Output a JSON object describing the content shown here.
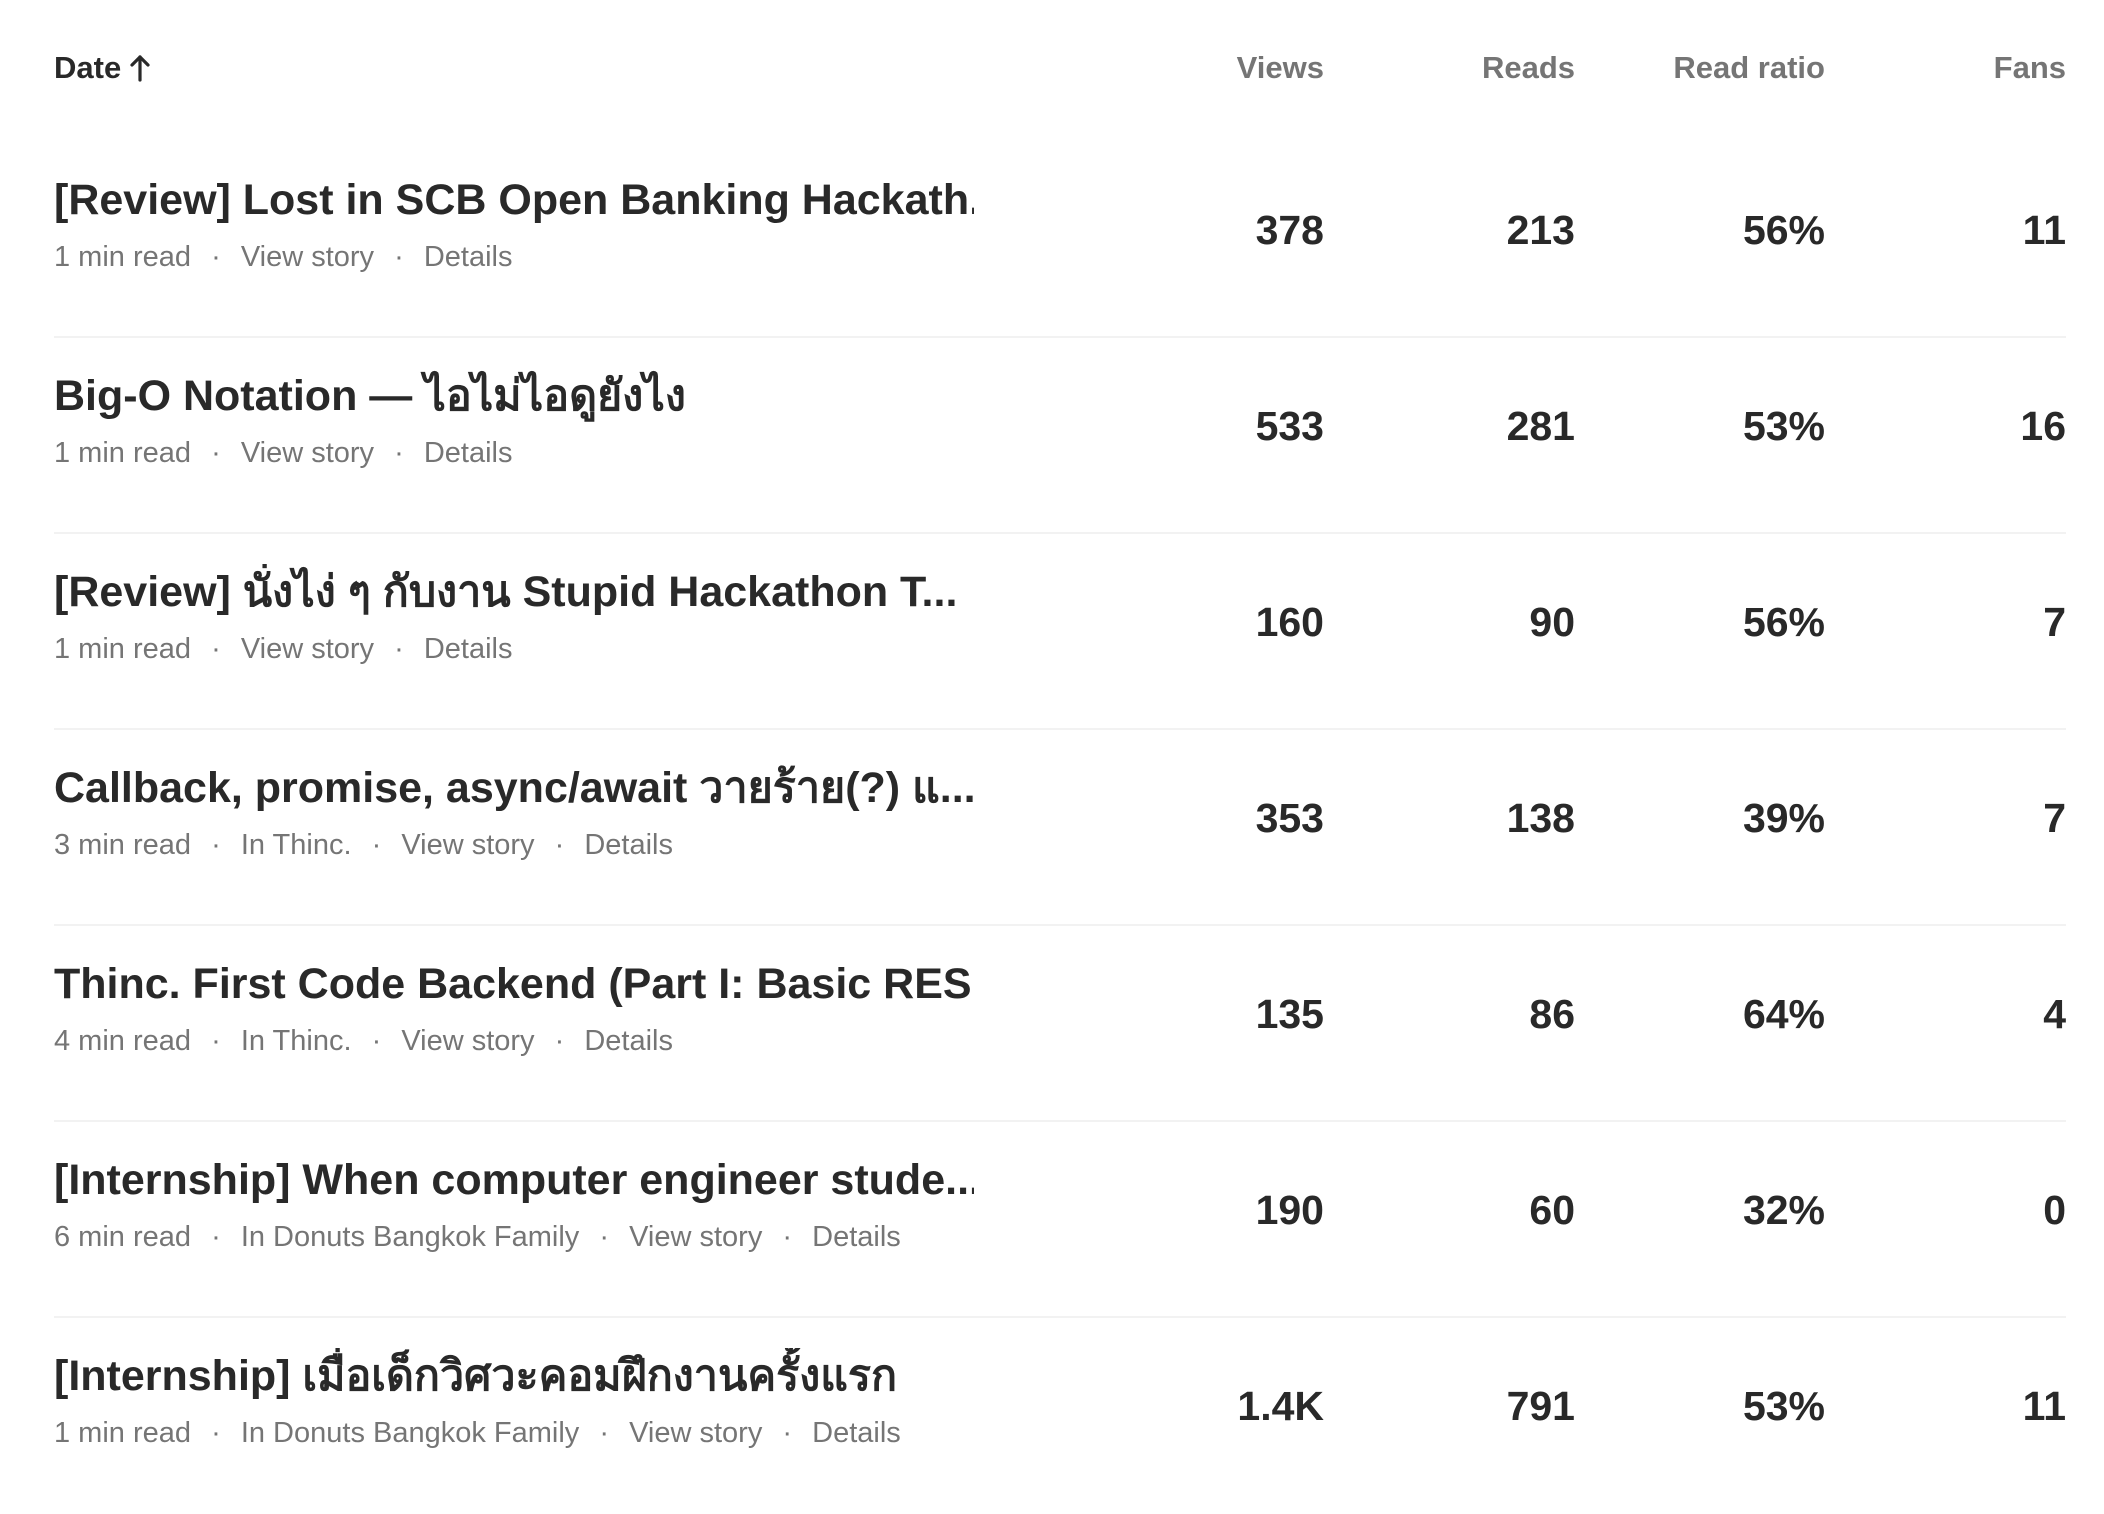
{
  "header": {
    "date_label": "Date",
    "views_label": "Views",
    "reads_label": "Reads",
    "read_ratio_label": "Read ratio",
    "fans_label": "Fans"
  },
  "rows": [
    {
      "title": "[Review] Lost in SCB Open Banking Hackath...",
      "read_time": "1 min read",
      "publication": "",
      "view_story": "View story",
      "details": "Details",
      "views": "378",
      "reads": "213",
      "read_ratio": "56%",
      "fans": "11"
    },
    {
      "title": "Big-O Notation — ไอไม่ไอดูยังไง",
      "read_time": "1 min read",
      "publication": "",
      "view_story": "View story",
      "details": "Details",
      "views": "533",
      "reads": "281",
      "read_ratio": "53%",
      "fans": "16"
    },
    {
      "title": "[Review] นั่งไง่ ๆ กับงาน Stupid Hackathon T...",
      "read_time": "1 min read",
      "publication": "",
      "view_story": "View story",
      "details": "Details",
      "views": "160",
      "reads": "90",
      "read_ratio": "56%",
      "fans": "7"
    },
    {
      "title": "Callback, promise, async/await วายร้าย(?) แ...",
      "read_time": "3 min read",
      "publication": "In Thinc.",
      "view_story": "View story",
      "details": "Details",
      "views": "353",
      "reads": "138",
      "read_ratio": "39%",
      "fans": "7"
    },
    {
      "title": "Thinc. First Code Backend (Part I: Basic RES...",
      "read_time": "4 min read",
      "publication": "In Thinc.",
      "view_story": "View story",
      "details": "Details",
      "views": "135",
      "reads": "86",
      "read_ratio": "64%",
      "fans": "4"
    },
    {
      "title": "[Internship] When computer engineer stude...",
      "read_time": "6 min read",
      "publication": "In Donuts Bangkok Family",
      "view_story": "View story",
      "details": "Details",
      "views": "190",
      "reads": "60",
      "read_ratio": "32%",
      "fans": "0"
    },
    {
      "title": "[Internship] เมื่อเด็กวิศวะคอมฝึกงานครั้งแรก",
      "read_time": "1 min read",
      "publication": "In Donuts Bangkok Family",
      "view_story": "View story",
      "details": "Details",
      "views": "1.4K",
      "reads": "791",
      "read_ratio": "53%",
      "fans": "11"
    }
  ],
  "icons": {
    "sort": "arrow-up-icon"
  },
  "colors": {
    "text_primary": "#292929",
    "text_secondary": "#757575",
    "divider": "#f2f2f2"
  }
}
